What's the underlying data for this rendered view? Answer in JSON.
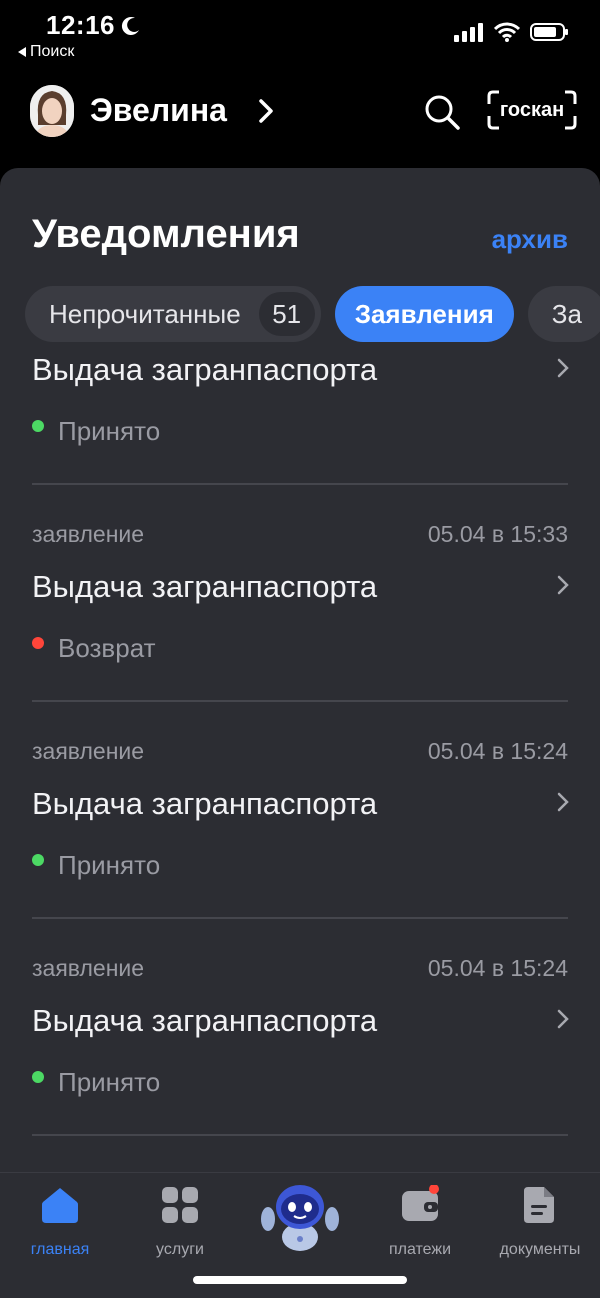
{
  "status_bar": {
    "time": "12:16",
    "back_label": "Поиск"
  },
  "header": {
    "user_name": "Эвелина",
    "goscan_label": "госкан"
  },
  "notifications": {
    "title": "Уведомления",
    "archive_label": "архив",
    "tabs": [
      {
        "label": "Непрочитанные",
        "count": "51"
      },
      {
        "label": "Заявления"
      },
      {
        "label": "За"
      }
    ],
    "items": [
      {
        "type": "",
        "date": "",
        "title": "Выдача загранпаспорта",
        "status": "Принято",
        "status_color": "#4cd964"
      },
      {
        "type": "заявление",
        "date": "05.04 в 15:33",
        "title": "Выдача загранпаспорта",
        "status": "Возврат",
        "status_color": "#ff453a"
      },
      {
        "type": "заявление",
        "date": "05.04 в 15:24",
        "title": "Выдача загранпаспорта",
        "status": "Принято",
        "status_color": "#4cd964"
      },
      {
        "type": "заявление",
        "date": "05.04 в 15:24",
        "title": "Выдача загранпаспорта",
        "status": "Принято",
        "status_color": "#4cd964"
      }
    ]
  },
  "bottom_nav": {
    "items": [
      {
        "label": "главная",
        "icon": "home-icon"
      },
      {
        "label": "услуги",
        "icon": "grid-icon"
      },
      {
        "label": "",
        "icon": "robot-assistant-icon"
      },
      {
        "label": "платежи",
        "icon": "wallet-icon"
      },
      {
        "label": "документы",
        "icon": "document-icon"
      }
    ]
  },
  "colors": {
    "accent": "#3b82f6",
    "card_bg": "#2c2d33",
    "accepted": "#4cd964",
    "returned": "#ff453a"
  }
}
